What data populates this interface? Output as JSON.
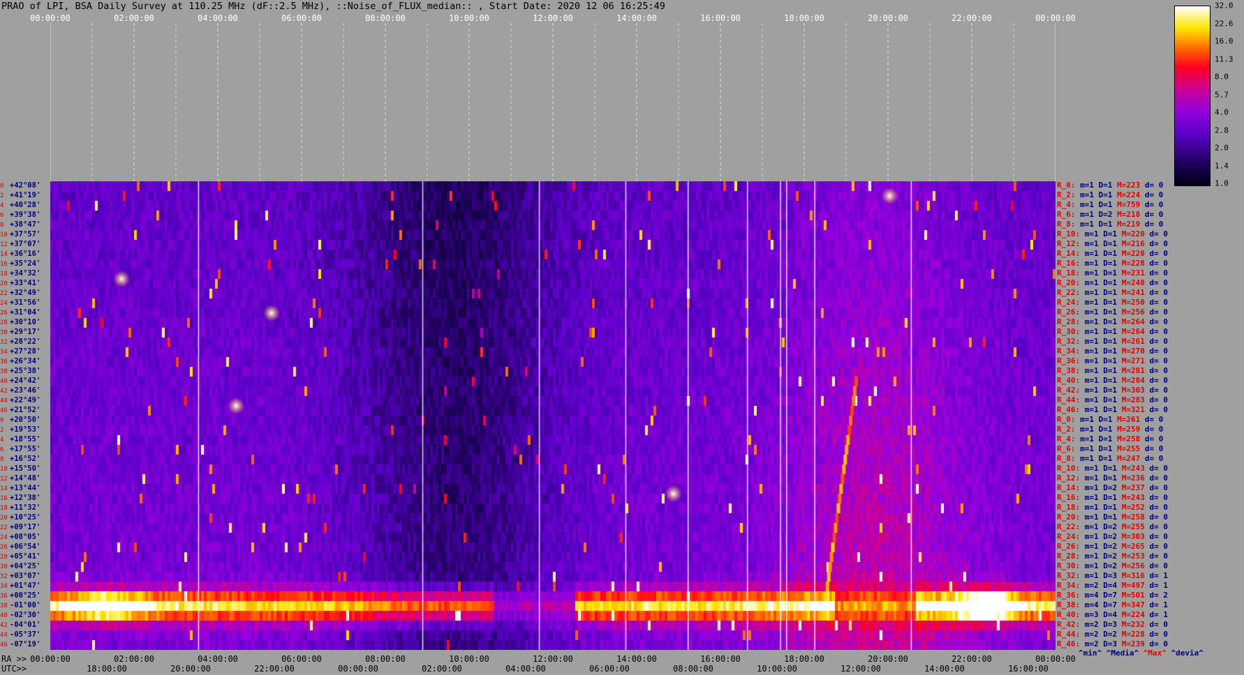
{
  "title": "PRAO of LPI, BSA Daily Survey at 110.25 MHz (dF::2.5 MHz), ::Noise_of_FLUX_median:: , Start Date: 2020 12 06 16:25:49",
  "chart_data": {
    "type": "heatmap",
    "title": "PRAO of LPI, BSA Daily Survey at 110.25 MHz (dF::2.5 MHz), ::Noise_of_FLUX_median:: , Start Date: 2020 12 06 16:25:49",
    "x_top_ticks": [
      "00:00:00",
      "02:00:00",
      "04:00:00",
      "06:00:00",
      "08:00:00",
      "10:00:00",
      "12:00:00",
      "14:00:00",
      "16:00:00",
      "18:00:00",
      "20:00:00",
      "22:00:00",
      "00:00:00"
    ],
    "ra_label": "RA >>",
    "ra_ticks": [
      "00:00:00",
      "02:00:00",
      "04:00:00",
      "06:00:00",
      "08:00:00",
      "10:00:00",
      "12:00:00",
      "14:00:00",
      "16:00:00",
      "18:00:00",
      "20:00:00",
      "22:00:00",
      "00:00:00"
    ],
    "utc_label": "UTC>>",
    "utc_ticks": [
      "18:00:00",
      "20:00:00",
      "22:00:00",
      "00:00:00",
      "02:00:00",
      "04:00:00",
      "06:00:00",
      "08:00:00",
      "10:00:00",
      "12:00:00",
      "14:00:00",
      "16:00:00"
    ],
    "declinations": [
      "+42°08'",
      "+41°19'",
      "+40°28'",
      "+39°38'",
      "+38°47'",
      "+37°57'",
      "+37°07'",
      "+36°16'",
      "+35°24'",
      "+34°32'",
      "+33°41'",
      "+32°49'",
      "+31°56'",
      "+31°04'",
      "+30°10'",
      "+29°17'",
      "+28°22'",
      "+27°28'",
      "+26°34'",
      "+25°38'",
      "+24°42'",
      "+23°46'",
      "+22°49'",
      "+21°52'",
      "+20°50'",
      "+19°53'",
      "+18°55'",
      "+17°55'",
      "+16°52'",
      "+15°50'",
      "+14°48'",
      "+13°44'",
      "+12°38'",
      "+11°32'",
      "+10°25'",
      "+09°17'",
      "+08°05'",
      "+06°54'",
      "+05°41'",
      "+04°25'",
      "+03°07'",
      "+01°47'",
      "+00°25'",
      "-01°00'",
      "-02°30'",
      "-04°01'",
      "-05°37'",
      "-07°19'"
    ],
    "row_indices": [
      "0",
      "2",
      "4",
      "6",
      "8",
      "10",
      "12",
      "14",
      "16",
      "18",
      "20",
      "22",
      "24",
      "26",
      "28",
      "30",
      "32",
      "34",
      "36",
      "38",
      "40",
      "42",
      "44",
      "46",
      "0",
      "2",
      "4",
      "6",
      "8",
      "10",
      "12",
      "14",
      "16",
      "18",
      "20",
      "22",
      "24",
      "26",
      "28",
      "30",
      "32",
      "34",
      "36",
      "38",
      "40",
      "42",
      "44",
      "46"
    ],
    "colorbar": {
      "ticks": [
        "32.0",
        "22.6",
        "16.0",
        "11.3",
        "8.0",
        "5.7",
        "4.0",
        "2.8",
        "2.0",
        "1.4",
        "1.0"
      ]
    },
    "stats": [
      {
        "r": "R_0:",
        "m": "m=1",
        "d": "D=1",
        "M": "M=223",
        "dv": "d= 0"
      },
      {
        "r": "R_2:",
        "m": "m=1",
        "d": "D=1",
        "M": "M=224",
        "dv": "d= 0"
      },
      {
        "r": "R_4:",
        "m": "m=1",
        "d": "D=1",
        "M": "M=759",
        "dv": "d= 0"
      },
      {
        "r": "R_6:",
        "m": "m=1",
        "d": "D=2",
        "M": "M=218",
        "dv": "d= 0"
      },
      {
        "r": "R_8:",
        "m": "m=1",
        "d": "D=1",
        "M": "M=219",
        "dv": "d= 0"
      },
      {
        "r": "R_10:",
        "m": "m=1",
        "d": "D=1",
        "M": "M=220",
        "dv": "d= 0"
      },
      {
        "r": "R_12:",
        "m": "m=1",
        "d": "D=1",
        "M": "M=216",
        "dv": "d= 0"
      },
      {
        "r": "R_14:",
        "m": "m=1",
        "d": "D=1",
        "M": "M=220",
        "dv": "d= 0"
      },
      {
        "r": "R_16:",
        "m": "m=1",
        "d": "D=1",
        "M": "M=228",
        "dv": "d= 0"
      },
      {
        "r": "R_18:",
        "m": "m=1",
        "d": "D=1",
        "M": "M=231",
        "dv": "d= 0"
      },
      {
        "r": "R_20:",
        "m": "m=1",
        "d": "D=1",
        "M": "M=240",
        "dv": "d= 0"
      },
      {
        "r": "R_22:",
        "m": "m=1",
        "d": "D=1",
        "M": "M=241",
        "dv": "d= 0"
      },
      {
        "r": "R_24:",
        "m": "m=1",
        "d": "D=1",
        "M": "M=250",
        "dv": "d= 0"
      },
      {
        "r": "R_26:",
        "m": "m=1",
        "d": "D=1",
        "M": "M=256",
        "dv": "d= 0"
      },
      {
        "r": "R_28:",
        "m": "m=1",
        "d": "D=1",
        "M": "M=264",
        "dv": "d= 0"
      },
      {
        "r": "R_30:",
        "m": "m=1",
        "d": "D=1",
        "M": "M=264",
        "dv": "d= 0"
      },
      {
        "r": "R_32:",
        "m": "m=1",
        "d": "D=1",
        "M": "M=261",
        "dv": "d= 0"
      },
      {
        "r": "R_34:",
        "m": "m=1",
        "d": "D=1",
        "M": "M=270",
        "dv": "d= 0"
      },
      {
        "r": "R_36:",
        "m": "m=1",
        "d": "D=1",
        "M": "M=271",
        "dv": "d= 0"
      },
      {
        "r": "R_38:",
        "m": "m=1",
        "d": "D=1",
        "M": "M=281",
        "dv": "d= 0"
      },
      {
        "r": "R_40:",
        "m": "m=1",
        "d": "D=1",
        "M": "M=284",
        "dv": "d= 0"
      },
      {
        "r": "R_42:",
        "m": "m=1",
        "d": "D=1",
        "M": "M=303",
        "dv": "d= 0"
      },
      {
        "r": "R_44:",
        "m": "m=1",
        "d": "D=1",
        "M": "M=283",
        "dv": "d= 0"
      },
      {
        "r": "R_46:",
        "m": "m=1",
        "d": "D=1",
        "M": "M=321",
        "dv": "d= 0"
      },
      {
        "r": "R_0:",
        "m": "m=1",
        "d": "D=1",
        "M": "M=261",
        "dv": "d= 0"
      },
      {
        "r": "R_2:",
        "m": "m=1",
        "d": "D=1",
        "M": "M=259",
        "dv": "d= 0"
      },
      {
        "r": "R_4:",
        "m": "m=1",
        "d": "D=1",
        "M": "M=258",
        "dv": "d= 0"
      },
      {
        "r": "R_6:",
        "m": "m=1",
        "d": "D=1",
        "M": "M=255",
        "dv": "d= 0"
      },
      {
        "r": "R_8:",
        "m": "m=1",
        "d": "D=1",
        "M": "M=247",
        "dv": "d= 0"
      },
      {
        "r": "R_10:",
        "m": "m=1",
        "d": "D=1",
        "M": "M=243",
        "dv": "d= 0"
      },
      {
        "r": "R_12:",
        "m": "m=1",
        "d": "D=1",
        "M": "M=236",
        "dv": "d= 0"
      },
      {
        "r": "R_14:",
        "m": "m=1",
        "d": "D=2",
        "M": "M=237",
        "dv": "d= 0"
      },
      {
        "r": "R_16:",
        "m": "m=1",
        "d": "D=1",
        "M": "M=243",
        "dv": "d= 0"
      },
      {
        "r": "R_18:",
        "m": "m=1",
        "d": "D=1",
        "M": "M=252",
        "dv": "d= 0"
      },
      {
        "r": "R_20:",
        "m": "m=1",
        "d": "D=1",
        "M": "M=258",
        "dv": "d= 0"
      },
      {
        "r": "R_22:",
        "m": "m=1",
        "d": "D=2",
        "M": "M=255",
        "dv": "d= 0"
      },
      {
        "r": "R_24:",
        "m": "m=1",
        "d": "D=2",
        "M": "M=303",
        "dv": "d= 0"
      },
      {
        "r": "R_26:",
        "m": "m=1",
        "d": "D=2",
        "M": "M=265",
        "dv": "d= 0"
      },
      {
        "r": "R_28:",
        "m": "m=1",
        "d": "D=2",
        "M": "M=253",
        "dv": "d= 0"
      },
      {
        "r": "R_30:",
        "m": "m=1",
        "d": "D=2",
        "M": "M=256",
        "dv": "d= 0"
      },
      {
        "r": "R_32:",
        "m": "m=1",
        "d": "D=3",
        "M": "M=316",
        "dv": "d= 1"
      },
      {
        "r": "R_34:",
        "m": "m=2",
        "d": "D=4",
        "M": "M=497",
        "dv": "d= 1"
      },
      {
        "r": "R_36:",
        "m": "m=4",
        "d": "D=7",
        "M": "M=501",
        "dv": "d= 2"
      },
      {
        "r": "R_38:",
        "m": "m=4",
        "d": "D=7",
        "M": "M=347",
        "dv": "d= 1"
      },
      {
        "r": "R_40:",
        "m": "m=3",
        "d": "D=4",
        "M": "M=224",
        "dv": "d= 1"
      },
      {
        "r": "R_42:",
        "m": "m=2",
        "d": "D=3",
        "M": "M=232",
        "dv": "d= 0"
      },
      {
        "r": "R_44:",
        "m": "m=2",
        "d": "D=2",
        "M": "M=228",
        "dv": "d= 0"
      },
      {
        "r": "R_46:",
        "m": "m=2",
        "d": "D=3",
        "M": "M=239",
        "dv": "d= 0"
      }
    ],
    "legend": {
      "min": "^min^",
      "media": "^Media^",
      "max": "^Max^",
      "devia": "^devia^"
    },
    "colors": {
      "background": "#a0a0a0",
      "low": "#000020",
      "mid": "#7a00d0",
      "high": "#ff2000",
      "peak": "#ffffff"
    }
  }
}
